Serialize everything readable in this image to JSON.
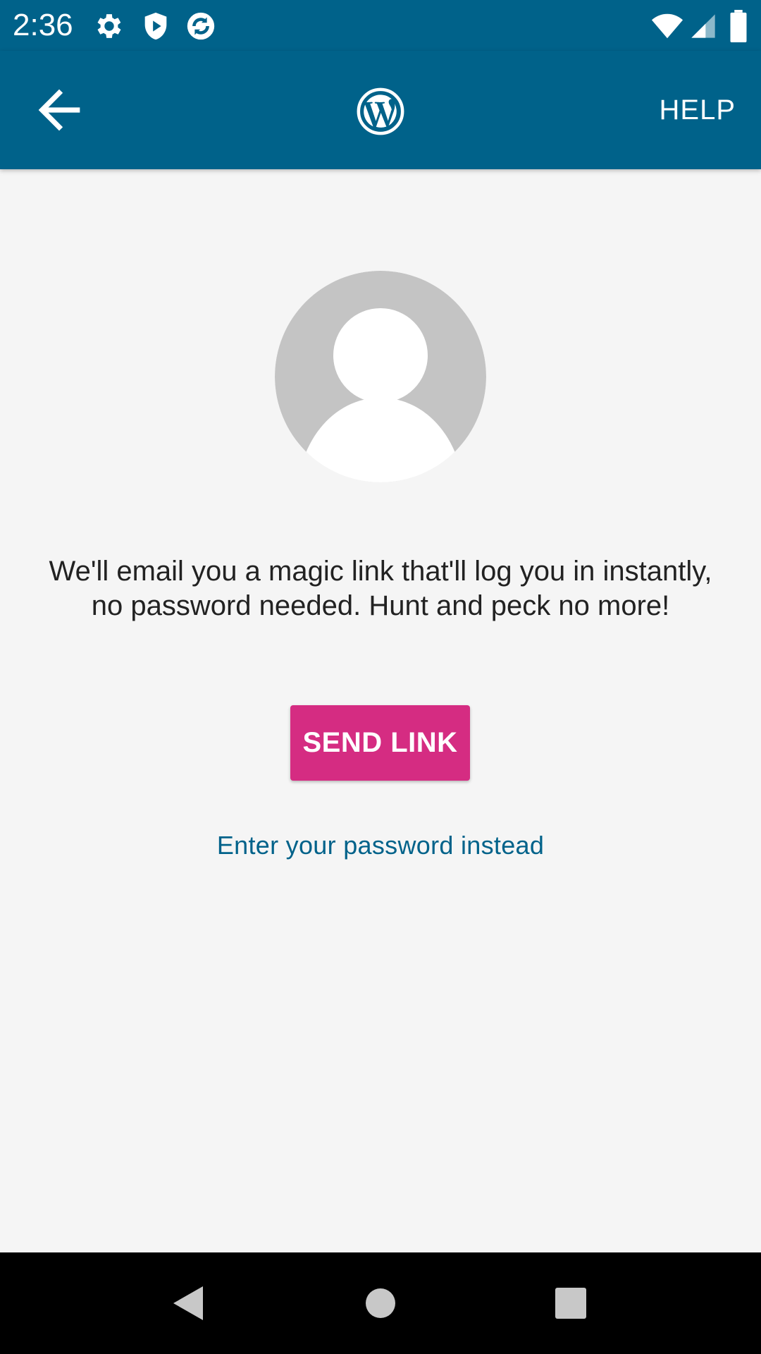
{
  "status_bar": {
    "time": "2:36",
    "left_icons": [
      "gear-icon",
      "shield-play-icon",
      "sync-app-icon"
    ],
    "right_icons": [
      "wifi-icon",
      "cell-signal-icon",
      "battery-icon"
    ]
  },
  "app_bar": {
    "back_icon": "arrow-left-icon",
    "logo_icon": "wordpress-logo-icon",
    "help_label": "HELP",
    "background_color": "#00628a"
  },
  "main": {
    "avatar_icon": "default-avatar-icon",
    "message_line1": "We'll email you a magic link that'll log you in instantly,",
    "message_line2": "no password needed. Hunt and peck no more!",
    "send_link_label": "SEND LINK",
    "send_link_color": "#d52c82",
    "password_link_label": "Enter your password instead",
    "link_color": "#00628a"
  },
  "nav_bar": {
    "buttons": [
      "back-triangle-icon",
      "home-circle-icon",
      "recents-square-icon"
    ]
  }
}
